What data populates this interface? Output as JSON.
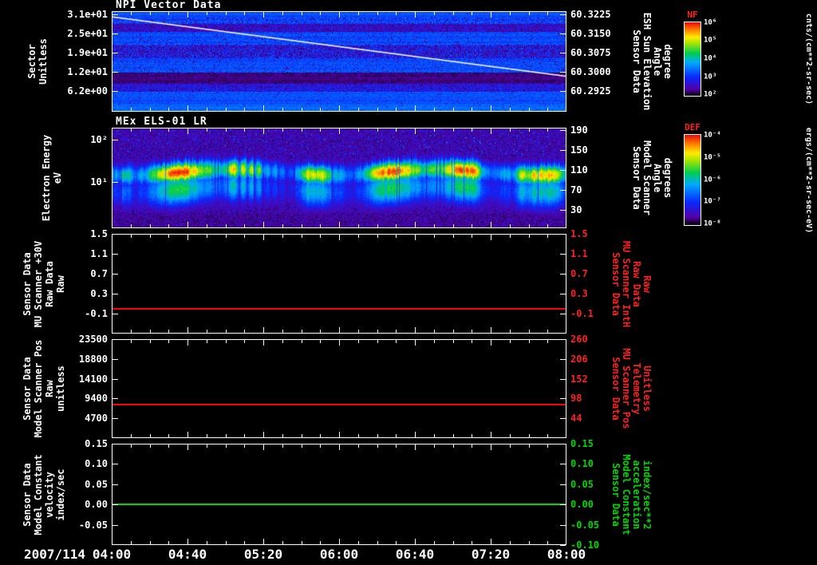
{
  "x_axis": {
    "date_label": "2007/114",
    "tick_labels": [
      "04:00",
      "04:40",
      "05:20",
      "06:00",
      "06:40",
      "07:20",
      "08:00"
    ],
    "start": "04:00",
    "end": "08:00"
  },
  "chart_data": [
    {
      "id": "npi",
      "type": "heatmap",
      "title": "NPI Vector Data",
      "ylabel_lines": [
        "Sector",
        "Unitless"
      ],
      "y_ticks": [
        {
          "label": "3.1e+01",
          "frac": 0.03
        },
        {
          "label": "2.5e+01",
          "frac": 0.22
        },
        {
          "label": "1.9e+01",
          "frac": 0.41
        },
        {
          "label": "1.2e+01",
          "frac": 0.6
        },
        {
          "label": "6.2e+00",
          "frac": 0.79
        }
      ],
      "right_label_lines": [
        "Sensor Data",
        "ESH Sun Elevation",
        "Angle",
        "degree"
      ],
      "right_color": "#ffffff",
      "right_ticks": [
        {
          "label": "60.3225",
          "frac": 0.03
        },
        {
          "label": "60.3150",
          "frac": 0.22
        },
        {
          "label": "60.3075",
          "frac": 0.41
        },
        {
          "label": "60.3000",
          "frac": 0.6
        },
        {
          "label": "60.2925",
          "frac": 0.79
        }
      ],
      "colorbar": {
        "label": "NF",
        "label_color": "#ff2020",
        "units": "cnts/(cm**2-sr-sec)",
        "ticks": [
          {
            "label": "10⁶",
            "frac": 0.02
          },
          {
            "label": "10⁵",
            "frac": 0.26
          },
          {
            "label": "10⁴",
            "frac": 0.5
          },
          {
            "label": "10³",
            "frac": 0.74
          },
          {
            "label": "10²",
            "frac": 0.98
          }
        ]
      },
      "overlay_line": {
        "color": "#ffffff",
        "from_frac": [
          0.0,
          0.05
        ],
        "to_frac": [
          1.0,
          0.65
        ],
        "meaning": "ESH Sun Elevation Angle decreasing from ~60.3215 to ~60.2985 degree over 04:00-08:00"
      },
      "stripes": [
        {
          "from": 0.0,
          "to": 0.05,
          "v": 0.31,
          "noise": 0.03,
          "speckle": 0.02
        },
        {
          "from": 0.05,
          "to": 0.12,
          "v": 0.29,
          "noise": 0.08,
          "speckle": 0.1
        },
        {
          "from": 0.12,
          "to": 0.2,
          "v": 0.16,
          "noise": 0.1,
          "speckle": 0.25
        },
        {
          "from": 0.2,
          "to": 0.33,
          "v": 0.3,
          "noise": 0.05,
          "speckle": 0.06
        },
        {
          "from": 0.33,
          "to": 0.46,
          "v": 0.23,
          "noise": 0.11,
          "speckle": 0.28
        },
        {
          "from": 0.46,
          "to": 0.61,
          "v": 0.3,
          "noise": 0.05,
          "speckle": 0.07
        },
        {
          "from": 0.61,
          "to": 0.72,
          "v": 0.06,
          "noise": 0.05,
          "speckle": 0.45
        },
        {
          "from": 0.72,
          "to": 0.8,
          "v": 0.2,
          "noise": 0.08,
          "speckle": 0.18
        },
        {
          "from": 0.8,
          "to": 0.93,
          "v": 0.31,
          "noise": 0.04,
          "speckle": 0.03
        },
        {
          "from": 0.93,
          "to": 1.01,
          "v": 0.35,
          "noise": 0.04,
          "speckle": 0.02
        }
      ]
    },
    {
      "id": "els",
      "type": "heatmap",
      "title": "MEx ELS-01 LR",
      "ylabel_lines": [
        "Electron Energy",
        "eV"
      ],
      "y_ticks": [
        {
          "label": "10²",
          "frac": 0.12
        },
        {
          "label": "10¹",
          "frac": 0.54
        }
      ],
      "right_label_lines": [
        "Sensor Data",
        "Model Scanner",
        "Angle",
        "degrees"
      ],
      "right_color": "#ffffff",
      "right_ticks": [
        {
          "label": "190",
          "frac": 0.02
        },
        {
          "label": "150",
          "frac": 0.22
        },
        {
          "label": "110",
          "frac": 0.42
        },
        {
          "label": "70",
          "frac": 0.62
        },
        {
          "label": "30",
          "frac": 0.82
        }
      ],
      "colorbar": {
        "label": "DEF",
        "label_color": "#ff2020",
        "units": "ergs/(cm**2-sr-sec-eV)",
        "ticks": [
          {
            "label": "10⁻⁴",
            "frac": 0.02
          },
          {
            "label": "10⁻⁵",
            "frac": 0.26
          },
          {
            "label": "10⁻⁶",
            "frac": 0.5
          },
          {
            "label": "10⁻⁷",
            "frac": 0.74
          },
          {
            "label": "10⁻⁸",
            "frac": 0.98
          }
        ]
      },
      "band": {
        "center_frac": 0.44,
        "width_frac": 0.1,
        "description": "Intense electron flux band near 20-40 eV: red-orange core with yellow-green halo, patchy/disrupted roughly 05:15-05:50, dark speckled background above and below"
      }
    },
    {
      "id": "mu-scanner-30v",
      "type": "line",
      "ylabel_lines": [
        "Sensor Data",
        "MU Scanner +30V",
        "Raw Data",
        "Raw"
      ],
      "ylim": [
        -0.5,
        1.5
      ],
      "y_ticks": [
        {
          "label": "1.5",
          "frac": 0.0
        },
        {
          "label": "1.1",
          "frac": 0.2
        },
        {
          "label": "0.7",
          "frac": 0.4
        },
        {
          "label": "0.3",
          "frac": 0.6
        },
        {
          "label": "-0.1",
          "frac": 0.8
        }
      ],
      "right_label_lines": [
        "Sensor Data",
        "MU Scanner IntH",
        "Raw Data",
        "Raw"
      ],
      "right_color": "#ff2020",
      "right_ticks": [
        {
          "label": "1.5",
          "frac": 0.0
        },
        {
          "label": "1.1",
          "frac": 0.2
        },
        {
          "label": "0.7",
          "frac": 0.4
        },
        {
          "label": "0.3",
          "frac": 0.6
        },
        {
          "label": "-0.1",
          "frac": 0.8
        }
      ],
      "series": [
        {
          "name": "MU Scanner +30V Raw Data",
          "color": "#ff0000",
          "constant_value": 0.0
        }
      ]
    },
    {
      "id": "scanner-pos",
      "type": "line",
      "ylabel_lines": [
        "Sensor Data",
        "Model Scanner Pos",
        "Raw",
        "unitless"
      ],
      "ylim": [
        0,
        23500
      ],
      "y_ticks": [
        {
          "label": "23500",
          "frac": 0.0
        },
        {
          "label": "18800",
          "frac": 0.2
        },
        {
          "label": "14100",
          "frac": 0.4
        },
        {
          "label": "9400",
          "frac": 0.6
        },
        {
          "label": "4700",
          "frac": 0.8
        }
      ],
      "right_label_lines": [
        "Sensor Data",
        "MU Scanner Pos",
        "Telemetry",
        "Unitless"
      ],
      "right_color": "#ff2020",
      "right_ticks": [
        {
          "label": "260",
          "frac": 0.0
        },
        {
          "label": "206",
          "frac": 0.2
        },
        {
          "label": "152",
          "frac": 0.4
        },
        {
          "label": "98",
          "frac": 0.6
        },
        {
          "label": "44",
          "frac": 0.8
        }
      ],
      "series": [
        {
          "name": "Model Scanner Pos Raw",
          "color": "#ff0000",
          "constant_value": 8000
        }
      ]
    },
    {
      "id": "model-constant",
      "type": "line",
      "ylabel_lines": [
        "Sensor Data",
        "Model Constant",
        "velocity",
        "index/sec"
      ],
      "ylim": [
        -0.1,
        0.15
      ],
      "y_ticks": [
        {
          "label": "0.15",
          "frac": 0.0
        },
        {
          "label": "0.10",
          "frac": 0.2
        },
        {
          "label": "0.05",
          "frac": 0.4
        },
        {
          "label": "0.00",
          "frac": 0.6
        },
        {
          "label": "-0.05",
          "frac": 0.8
        }
      ],
      "right_label_lines": [
        "Sensor Data",
        "Model Constant",
        "acceleration",
        "index/sec**2"
      ],
      "right_color": "#00d800",
      "right_ticks": [
        {
          "label": "0.15",
          "frac": 0.0
        },
        {
          "label": "0.10",
          "frac": 0.2
        },
        {
          "label": "0.05",
          "frac": 0.4
        },
        {
          "label": "0.00",
          "frac": 0.6
        },
        {
          "label": "-0.05",
          "frac": 0.8
        },
        {
          "label": "-0.10",
          "frac": 1.0
        }
      ],
      "series": [
        {
          "name": "Model Constant velocity",
          "color": "#00d800",
          "constant_value": 0.0
        }
      ]
    }
  ]
}
